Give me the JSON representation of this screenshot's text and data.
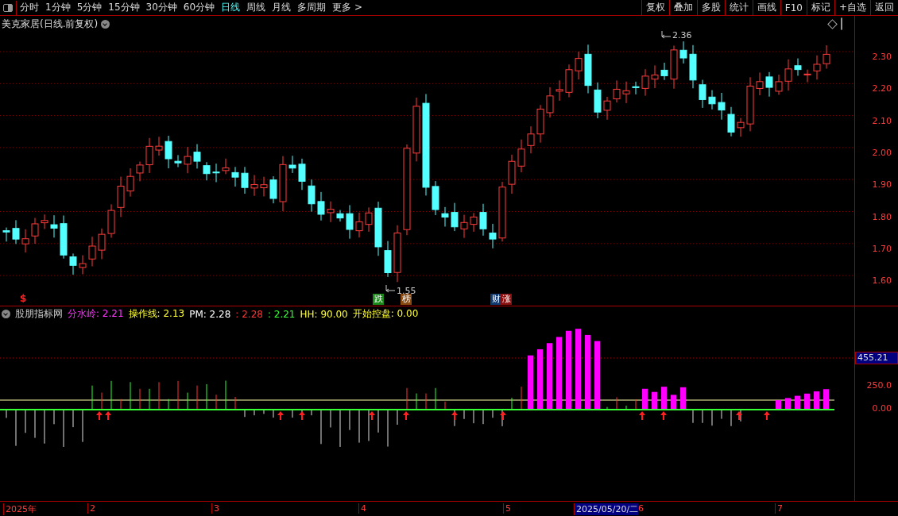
{
  "toolbar": {
    "periods": [
      {
        "label": "分时",
        "selected": false
      },
      {
        "label": "1分钟",
        "selected": false
      },
      {
        "label": "5分钟",
        "selected": false
      },
      {
        "label": "15分钟",
        "selected": false
      },
      {
        "label": "30分钟",
        "selected": false
      },
      {
        "label": "60分钟",
        "selected": false
      },
      {
        "label": "日线",
        "selected": true
      },
      {
        "label": "周线",
        "selected": false
      },
      {
        "label": "月线",
        "selected": false
      },
      {
        "label": "多周期",
        "selected": false
      },
      {
        "label": "更多 >",
        "selected": false
      }
    ],
    "buttons": [
      "复权",
      "叠加",
      "多股",
      "统计",
      "画线",
      "F10",
      "标记",
      "+自选",
      "返回"
    ]
  },
  "price_chart": {
    "title": "美克家居(日线.前复权)",
    "axis_labels": [
      "2.30",
      "2.20",
      "2.10",
      "2.00",
      "1.90",
      "1.80",
      "1.70",
      "1.60"
    ],
    "high_label": "2.36",
    "low_label": "1.55",
    "marker": "$",
    "badges": [
      {
        "text": "跌",
        "color": "#1a8a1a"
      },
      {
        "text": "榜",
        "color": "#8a4a10"
      },
      {
        "text": "财",
        "color": "#103a70"
      },
      {
        "text": "涨",
        "color": "#8a1010"
      }
    ]
  },
  "indicator": {
    "name": "股朋指标网",
    "legend": [
      {
        "text": "分水岭: 2.21",
        "color": "#ff33ff"
      },
      {
        "text": "操作线: 2.13",
        "color": "#ffff33"
      },
      {
        "text": "PM: 2.28",
        "color": "#ffffff"
      },
      {
        "text": ": 2.28",
        "color": "#ff3333"
      },
      {
        "text": ": 2.21",
        "color": "#33ff33"
      },
      {
        "text": "HH: 90.00",
        "color": "#ffff33"
      },
      {
        "text": "开始控盘: 0.00",
        "color": "#ffff33"
      }
    ],
    "cursor_value": "455.21",
    "axis_labels": [
      "250.0",
      "0.00"
    ]
  },
  "date_axis": {
    "labels": [
      "2025年",
      "2",
      "3",
      "4",
      "5",
      "6",
      "7"
    ],
    "cursor_date": "2025/05/20/二"
  }
}
